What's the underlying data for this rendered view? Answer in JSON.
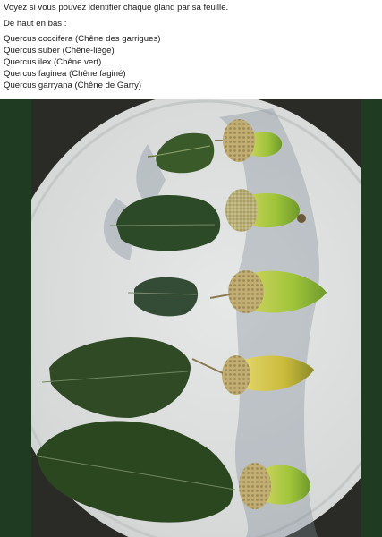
{
  "post": {
    "intro": "Voyez si vous pouvez identifier chaque gland par sa feuille.",
    "subhead": "De haut en bas :",
    "species": [
      "Quercus coccifera (Chêne des garrigues)",
      "Quercus suber (Chêne-liège)",
      "Quercus ilex (Chêne vert)",
      "Quercus faginea (Chêne faginé)",
      "Quercus garryana (Chêne de Garry)"
    ]
  },
  "photo": {
    "subject": "acorns-and-oak-leaves",
    "count": 5
  },
  "colors": {
    "frame_background": "#1f3b22",
    "plate": "#dcdedd",
    "leaf_dark": "#2c4a28",
    "acorn_green": "#9fc43a",
    "acorn_yellow": "#d6c63e",
    "cup": "#b9a56b"
  }
}
